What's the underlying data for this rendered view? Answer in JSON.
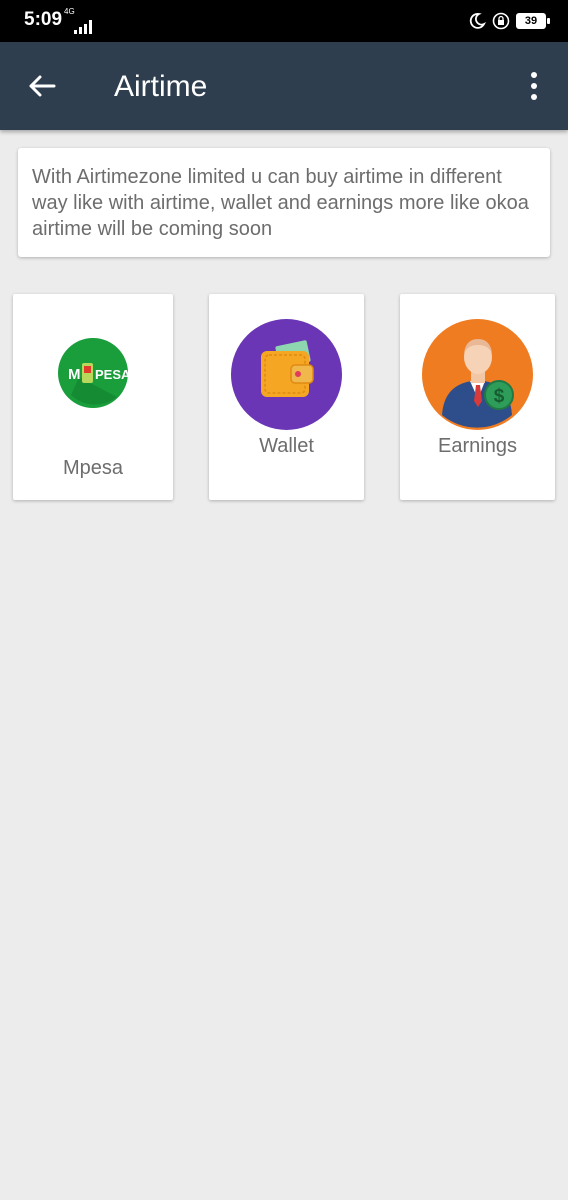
{
  "status_bar": {
    "time": "5:09",
    "network": "4G",
    "battery": "39"
  },
  "app_bar": {
    "title": "Airtime"
  },
  "info": {
    "text": "With Airtimezone limited u can buy airtime in different way like with airtime, wallet and earnings more like okoa airtime will be coming soon"
  },
  "options": [
    {
      "label": "Mpesa",
      "icon": "mpesa-logo",
      "color": "#1a9e3c",
      "logo_text_left": "M",
      "logo_text_right": "PESA"
    },
    {
      "label": "Wallet",
      "icon": "wallet-icon",
      "color": "#6a36b5"
    },
    {
      "label": "Earnings",
      "icon": "businessman-dollar-icon",
      "color": "#f07c22"
    }
  ],
  "colors": {
    "app_bar": "#2e3e4f",
    "background": "#ececec",
    "text": "#6d6d6d"
  }
}
